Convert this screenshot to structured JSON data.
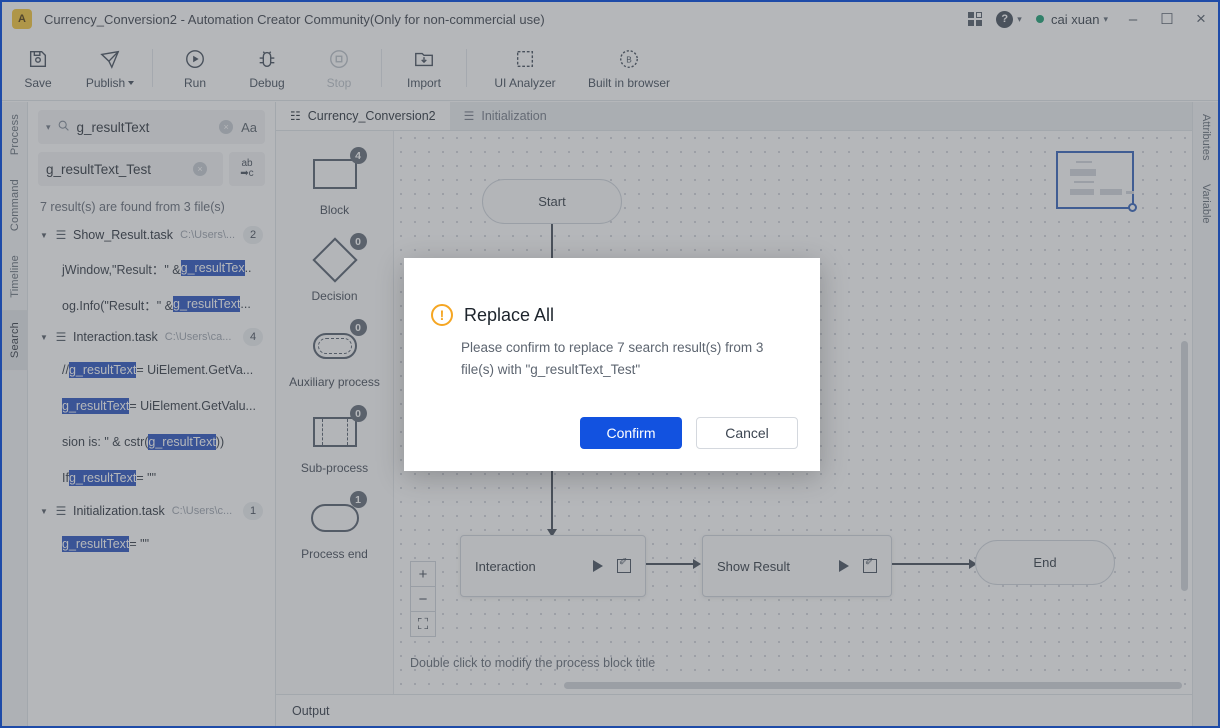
{
  "window": {
    "logo_text": "A",
    "title": "Currency_Conversion2 - Automation Creator Community(Only for non-commercial use)",
    "user_name": "cai xuan",
    "minimize": "–",
    "maximize": "☐",
    "close": "×",
    "help_glyph": "?"
  },
  "toolbar": {
    "items": [
      {
        "label": "Save",
        "icon": "save-icon"
      },
      {
        "label": "Publish",
        "icon": "publish-icon",
        "caret": true
      },
      {
        "label": "Run",
        "icon": "run-icon"
      },
      {
        "label": "Debug",
        "icon": "debug-icon"
      },
      {
        "label": "Stop",
        "icon": "stop-icon",
        "disabled": true
      },
      {
        "label": "Import",
        "icon": "import-icon"
      },
      {
        "label": "UI Analyzer",
        "icon": "ui-analyzer-icon"
      },
      {
        "label": "Built in browser",
        "icon": "browser-icon"
      }
    ]
  },
  "left_rail": {
    "tabs": [
      "Process",
      "Command",
      "Timeline",
      "Search"
    ],
    "active": "Search"
  },
  "right_rail": {
    "tabs": [
      "Attributes",
      "Variable"
    ]
  },
  "search_panel": {
    "find_value": "g_resultText",
    "find_chevron": "⌄",
    "search_icon": "search-icon",
    "clear_glyph": "×",
    "match_case_label": "Aa",
    "replace_value": "g_resultText_Test",
    "replace_button_top": "ab",
    "replace_button_bottom": "➡c",
    "result_summary": "7 result(s) are found from 3 file(s)",
    "files": [
      {
        "name": "Show_Result.task",
        "path": "C:\\Users\\...",
        "count": "2",
        "hits": [
          {
            "pre": "jWindow,\"Result：\" & ",
            "match": "g_resultTex",
            "post": ".."
          },
          {
            "pre": "og.Info(\"Result：\" & ",
            "match": "g_resultText",
            "post": " ..."
          }
        ]
      },
      {
        "name": "Interaction.task",
        "path": "C:\\Users\\ca...",
        "count": "4",
        "hits": [
          {
            "pre": "// ",
            "match": "g_resultText",
            "post": " = UiElement.GetVa..."
          },
          {
            "pre": "",
            "match": "g_resultText",
            "post": " = UiElement.GetValu..."
          },
          {
            "pre": "sion is: \" & cstr(",
            "match": "g_resultText",
            "post": "))"
          },
          {
            "pre": "If ",
            "match": "g_resultText",
            "post": " = \"\""
          }
        ]
      },
      {
        "name": "Initialization.task",
        "path": "C:\\Users\\c...",
        "count": "1",
        "hits": [
          {
            "pre": "",
            "match": "g_resultText",
            "post": " = \"\""
          }
        ]
      }
    ]
  },
  "editor_tabs": [
    {
      "label": "Currency_Conversion2",
      "icon": "process-icon",
      "active": true
    },
    {
      "label": "Initialization",
      "icon": "stack-icon",
      "active": false
    }
  ],
  "toolbox": {
    "shapes": [
      {
        "label": "Block",
        "count": "4",
        "shape": "rect"
      },
      {
        "label": "Decision",
        "count": "0",
        "shape": "diamond"
      },
      {
        "label": "Auxiliary process",
        "count": "0",
        "shape": "aux"
      },
      {
        "label": "Sub-process",
        "count": "0",
        "shape": "sub"
      },
      {
        "label": "Process end",
        "count": "1",
        "shape": "end"
      }
    ]
  },
  "canvas": {
    "nodes": [
      {
        "label": "Start",
        "type": "round"
      },
      {
        "label": "Interaction",
        "type": "block"
      },
      {
        "label": "Show Result",
        "type": "block"
      },
      {
        "label": "End",
        "type": "round"
      }
    ],
    "hint": "Double click to modify the process block title",
    "zoom_in": "+",
    "zoom_out": "−",
    "fit": "⛶"
  },
  "output": {
    "label": "Output"
  },
  "modal": {
    "title": "Replace All",
    "icon": "warning-icon",
    "icon_glyph": "!",
    "message": "Please confirm to replace 7 search result(s) from 3 file(s) with \"g_resultText_Test\"",
    "confirm_label": "Confirm",
    "cancel_label": "Cancel",
    "confirm_color": "#1252e0"
  }
}
